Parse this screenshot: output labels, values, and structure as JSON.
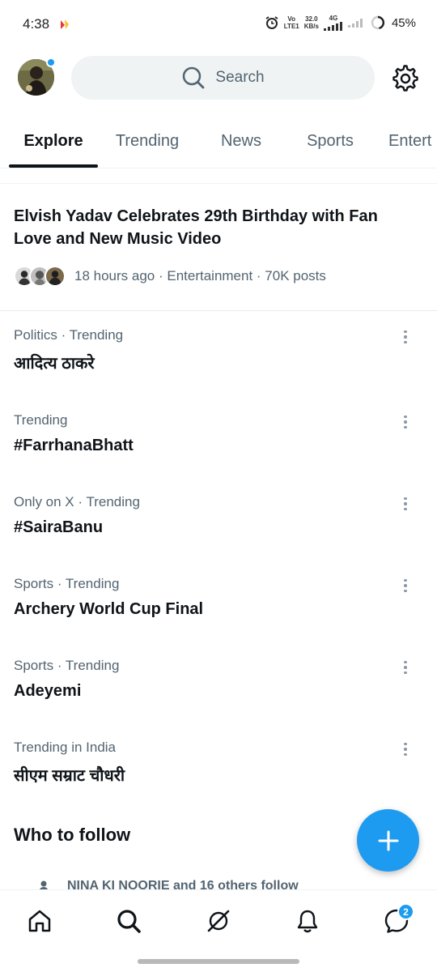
{
  "status_bar": {
    "time": "4:38",
    "net_top": "Vo",
    "net_bottom": "LTE1",
    "speed_value": "32.0",
    "speed_unit": "KB/s",
    "network_type": "4G",
    "battery": "45%"
  },
  "header": {
    "search_placeholder": "Search"
  },
  "tabs": [
    {
      "label": "Explore",
      "active": true
    },
    {
      "label": "Trending",
      "active": false
    },
    {
      "label": "News",
      "active": false
    },
    {
      "label": "Sports",
      "active": false
    },
    {
      "label": "Entert",
      "active": false
    }
  ],
  "featured": {
    "title": "Elvish Yadav Celebrates 29th Birthday with Fan Love and New Music Video",
    "meta": "18 hours ago · Entertainment · 70K posts"
  },
  "trends": [
    {
      "context": "Politics · Trending",
      "name": "आदित्य ठाकरे"
    },
    {
      "context": "Trending",
      "name": "#FarrhanaBhatt"
    },
    {
      "context": "Only on X · Trending",
      "name": "#SairaBanu"
    },
    {
      "context": "Sports · Trending",
      "name": "Archery World Cup Final"
    },
    {
      "context": "Sports · Trending",
      "name": "Adeyemi"
    },
    {
      "context": "Trending in India",
      "name": "सीएम सम्राट चौधरी"
    }
  ],
  "who_to_follow": {
    "title": "Who to follow",
    "first_row_text": "NINA KI NOORIE and 16 others follow"
  },
  "bottom_nav": {
    "items": [
      "home-icon",
      "search-icon",
      "grok-icon",
      "notifications-icon",
      "messages-icon"
    ],
    "messages_badge": "2"
  },
  "colors": {
    "accent": "#1d9bf0",
    "text_primary": "#0f1419",
    "text_secondary": "#536471",
    "search_bg": "#eff3f4"
  }
}
